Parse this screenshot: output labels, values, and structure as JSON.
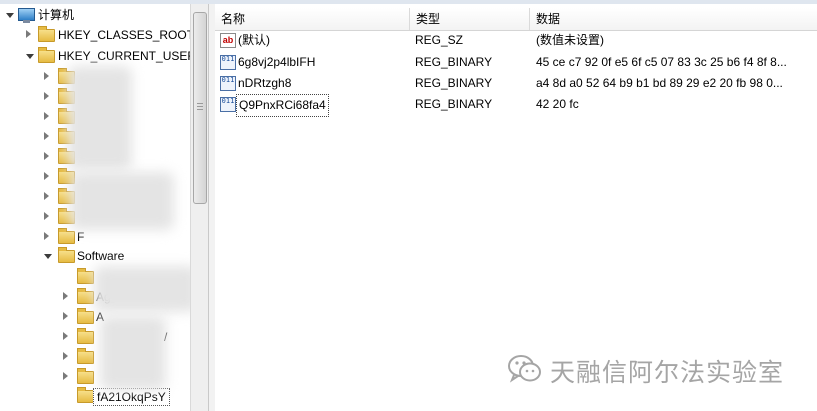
{
  "tree": {
    "root_label": "计算机",
    "hives": [
      {
        "label": "HKEY_CLASSES_ROOT"
      },
      {
        "label": "HKEY_CURRENT_USER"
      }
    ],
    "software_label": "Software",
    "partial_labels": [
      "Ag",
      "A",
      "/",
      "F"
    ],
    "selected_key": "fA21OkqPsY"
  },
  "list": {
    "columns": [
      "名称",
      "类型",
      "数据"
    ],
    "rows": [
      {
        "icon": "string-value-icon",
        "icon_glyph": "ab",
        "name": "(默认)",
        "type": "REG_SZ",
        "data": "(数值未设置)"
      },
      {
        "icon": "binary-value-icon",
        "icon_glyph": "011",
        "name": "6g8vj2p4lbIFH",
        "type": "REG_BINARY",
        "data": "45 ce c7 92 0f e5 6f c5 07 83 3c 25 b6 f4 8f 8..."
      },
      {
        "icon": "binary-value-icon",
        "icon_glyph": "011",
        "name": "nDRtzgh8",
        "type": "REG_BINARY",
        "data": "a4 8d a0 52 64 b9 b1 bd 89 29 e2 20 fb 98 0..."
      },
      {
        "icon": "binary-value-icon",
        "icon_glyph": "011",
        "name": "Q9PnxRCi68fa4",
        "type": "REG_BINARY",
        "data": "42 20 fc"
      }
    ]
  },
  "watermark": {
    "text": "天融信阿尔法实验室",
    "icon": "wechat-icon"
  },
  "colors": {
    "folder": "#e6bb43",
    "header_bg": "#f3f3f3",
    "watermark": "#a5a5a5"
  }
}
